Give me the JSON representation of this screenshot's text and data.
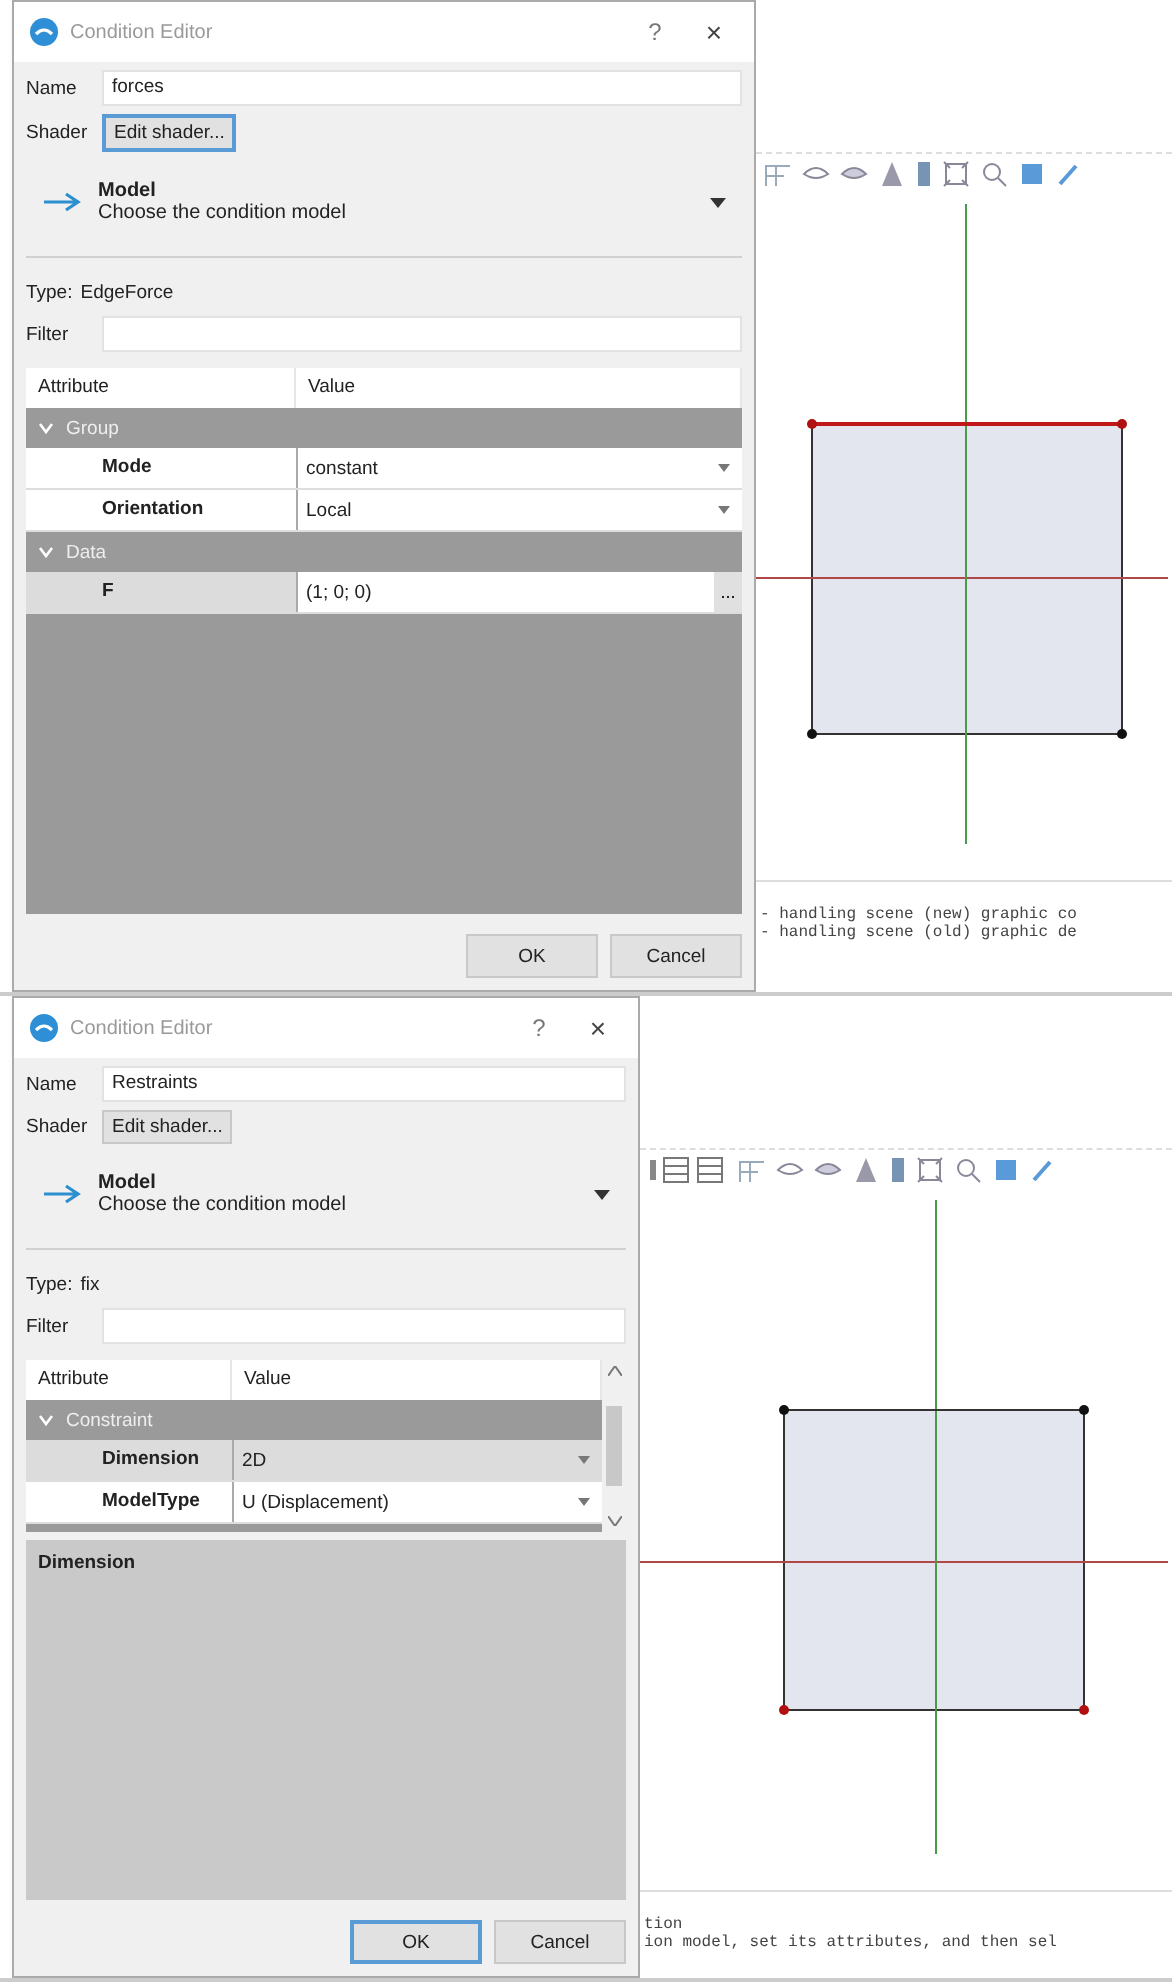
{
  "panels": [
    {
      "dialog": {
        "title": "Condition Editor",
        "help": "?",
        "close": "×",
        "name": {
          "label": "Name",
          "value": "forces"
        },
        "shader": {
          "label": "Shader",
          "button": "Edit shader...",
          "focused": true
        },
        "model": {
          "title": "Model",
          "subtitle": "Choose the condition model"
        },
        "type": {
          "label": "Type:",
          "value": "EdgeForce"
        },
        "filter": {
          "label": "Filter"
        },
        "table": {
          "columns": [
            "Attribute",
            "Value"
          ],
          "scrollbar": false,
          "groups": [
            {
              "name": "Group",
              "expanded": true,
              "rows": [
                {
                  "attribute": "Mode",
                  "value": "constant",
                  "kind": "dropdown",
                  "selected": false
                },
                {
                  "attribute": "Orientation",
                  "value": "Local",
                  "kind": "dropdown",
                  "selected": false
                }
              ]
            },
            {
              "name": "Data",
              "expanded": true,
              "rows": [
                {
                  "attribute": "F",
                  "value": "(1; 0; 0)",
                  "kind": "editor",
                  "button": "...",
                  "selected": true
                }
              ]
            }
          ]
        },
        "buttons": [
          {
            "label": "OK",
            "focused": false
          },
          {
            "label": "Cancel",
            "focused": false
          }
        ]
      },
      "viewport": {
        "leading_tools": false,
        "top_edge_selected": true,
        "bottom_vertices_selected": false,
        "console": [
          "- handling scene (new) graphic co",
          "- handling scene (old) graphic de"
        ]
      }
    },
    {
      "dialog": {
        "title": "Condition Editor",
        "help": "?",
        "close": "×",
        "name": {
          "label": "Name",
          "value": "Restraints"
        },
        "shader": {
          "label": "Shader",
          "button": "Edit shader...",
          "focused": false
        },
        "model": {
          "title": "Model",
          "subtitle": "Choose the condition model"
        },
        "type": {
          "label": "Type:",
          "value": "fix"
        },
        "filter": {
          "label": "Filter"
        },
        "table": {
          "columns": [
            "Attribute",
            "Value"
          ],
          "scrollbar": true,
          "groups": [
            {
              "name": "Constraint",
              "expanded": true,
              "rows": [
                {
                  "attribute": "Dimension",
                  "value": "2D",
                  "kind": "dropdown",
                  "selected": true
                },
                {
                  "attribute": "ModelType",
                  "value": "U (Displacement)",
                  "kind": "dropdown",
                  "selected": false
                }
              ]
            }
          ]
        },
        "description": "Dimension",
        "buttons": [
          {
            "label": "OK",
            "focused": true
          },
          {
            "label": "Cancel",
            "focused": false
          }
        ]
      },
      "viewport": {
        "leading_tools": true,
        "top_edge_selected": false,
        "bottom_vertices_selected": true,
        "console": [
          "tion",
          "ion model, set its attributes, and then sel"
        ]
      }
    }
  ]
}
